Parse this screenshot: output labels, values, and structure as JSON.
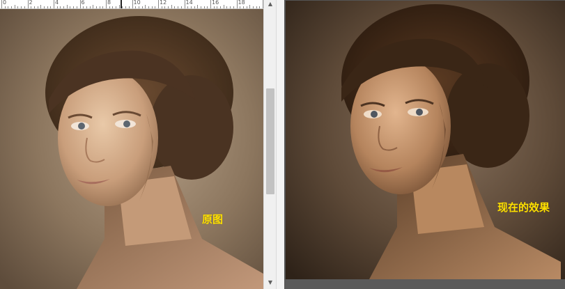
{
  "left_panel": {
    "ruler_labels": [
      "0",
      "2",
      "4",
      "6",
      "8",
      "10",
      "12",
      "14",
      "16",
      "18"
    ],
    "caption": "原图"
  },
  "right_panel": {
    "caption": "现在的效果"
  },
  "scrollbar": {
    "up_icon": "arrow-up-icon",
    "down_icon": "arrow-down-icon"
  },
  "colors": {
    "caption": "#ffe100",
    "left_background": "#7a6650",
    "right_background": "#4e3d2e",
    "hair": "#3e2a1c"
  }
}
